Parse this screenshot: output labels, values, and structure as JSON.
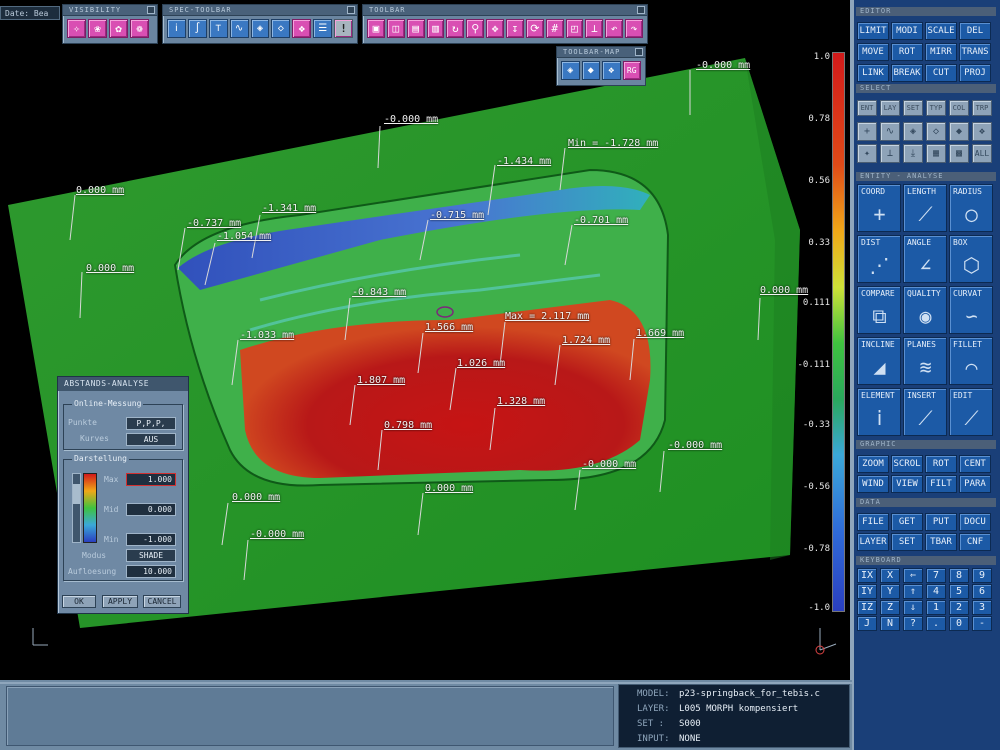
{
  "window": {
    "date_label": "Date: Bea"
  },
  "toolbars": {
    "visibility_title": "VISIBILITY",
    "spec_toolbar_title": "SPEC-TOOLBAR",
    "toolbar_title": "TOOLBAR",
    "toolbar_map_title": "TOOLBAR-MAP",
    "map_rg_label": "RG",
    "grid_glyph": "#"
  },
  "color_scale": {
    "labels": [
      "1.0",
      "0.78",
      "0.56",
      "0.33",
      "0.111",
      "-0.111",
      "-0.33",
      "-0.56",
      "-0.78",
      "-1.0"
    ]
  },
  "measurements": [
    "-0.000 mm",
    "-0.000 mm",
    "0.000 mm",
    "-1.434 mm",
    "Min = -1.728 mm",
    "-0.737 mm",
    "-1.341 mm",
    "-1.054 mm",
    "-0.715 mm",
    "-0.701 mm",
    "0.000 mm",
    "0.000 mm",
    "-0.843 mm",
    "1.566 mm",
    "Max = 2.117 mm",
    "-1.033 mm",
    "1.724 mm",
    "1.669 mm",
    "1.807 mm",
    "1.026 mm",
    "1.328 mm",
    "0.798 mm",
    "-0.000 mm",
    "-0.000 mm",
    "0.000 mm",
    "0.000 mm",
    "-0.000 mm"
  ],
  "dialog": {
    "title": "ABSTANDS-ANALYSE",
    "online_group": "Online-Messung",
    "punkte_label": "Punkte",
    "punkte_value": "P,P,P,",
    "kurves_label": "Kurves",
    "kurves_value": "AUS",
    "darstellung_group": "Darstellung",
    "max_label": "Max",
    "max_value": "1.000",
    "mid_label": "Mid",
    "mid_value": "0.000",
    "min_label": "Min",
    "min_value": "-1.000",
    "modus_label": "Modus",
    "modus_value": "SHADE",
    "aufloesung_label": "Aufloesung",
    "aufloesung_value": "10.000",
    "ok_label": "OK",
    "apply_label": "APPLY",
    "cancel_label": "CANCEL"
  },
  "sidepanel": {
    "editor_title": "EDITOR",
    "editor_buttons": [
      "LIMIT",
      "MODI",
      "SCALE",
      "DEL",
      "MOVE",
      "ROT",
      "MIRR",
      "TRANS",
      "LINK",
      "BREAK",
      "CUT",
      "PROJ"
    ],
    "select_title": "SELECT",
    "select_buttons": [
      "ENT",
      "LAY",
      "SET",
      "TYP",
      "COL",
      "TRP"
    ],
    "select_all_label": "ALL",
    "entity_title": "ENTITY - ANALYSE",
    "analyse_buttons": [
      "COORD",
      "LENGTH",
      "RADIUS",
      "DIST",
      "ANGLE",
      "BOX",
      "COMPARE",
      "QUALITY",
      "CURVAT",
      "INCLINE",
      "PLANES",
      "FILLET",
      "ELEMENT",
      "INSERT",
      "EDIT"
    ],
    "graphic_title": "GRAPHIC",
    "graphic_buttons": [
      "ZOOM",
      "SCROL",
      "ROT",
      "CENT",
      "WIND",
      "VIEW",
      "FILT",
      "PARA"
    ],
    "data_title": "DATA",
    "data_buttons": [
      "FILE",
      "GET",
      "PUT",
      "DOCU",
      "LAYER",
      "SET",
      "TBAR",
      "CNF"
    ],
    "keyboard_title": "KEYBOARD",
    "keyboard_keys": [
      "IX",
      "X",
      "⇐",
      "7",
      "8",
      "9",
      "IY",
      "Y",
      "⇑",
      "4",
      "5",
      "6",
      "IZ",
      "Z",
      "⇓",
      "1",
      "2",
      "3",
      "J",
      "N",
      "?",
      ".",
      "0",
      "-"
    ]
  },
  "status": {
    "model_key": "MODEL:",
    "model_value": "p23-springback_for_tebis.c",
    "layer_key": "LAYER:",
    "layer_value": "L005 MORPH kompensiert",
    "set_key": "SET  :",
    "set_value": "S000",
    "input_key": "INPUT:",
    "input_value": "NONE"
  }
}
